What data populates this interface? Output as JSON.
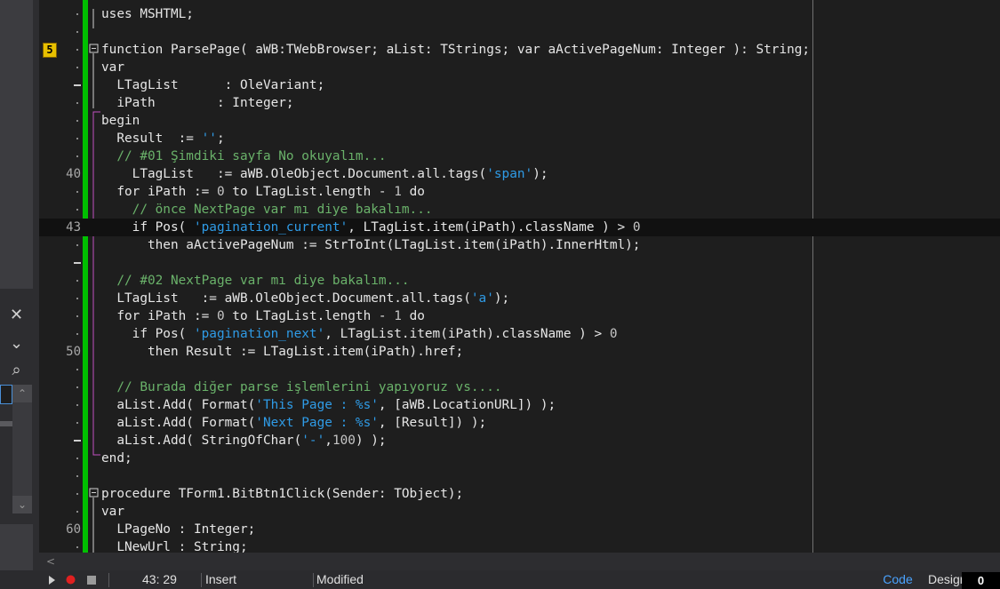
{
  "sidebar": {
    "close_glyph": "✕",
    "chevron_down": "⌄",
    "search_glyph": "⌕",
    "scroll_up": "⌃",
    "scroll_down": "⌄"
  },
  "gutter": {
    "bookmark": "5",
    "ln_40": "40",
    "ln_43": "43",
    "ln_50": "50",
    "ln_60": "60"
  },
  "code": {
    "l1": "uses MSHTML;",
    "l3_kw": "function",
    "l3_rest": " ParsePage( aWB:TWebBrowser; aList: TStrings; ",
    "l3_kw2": "var",
    "l3_rest2": " aActivePageNum: Integer ): String;",
    "l4": "var",
    "l5": "  LTagList      : OleVariant;",
    "l6": "  iPath        : Integer;",
    "l7": "begin",
    "l8_a": "  Result  := ",
    "l8_s": "''",
    "l8_b": ";",
    "l9": "  // #01 Şimdiki sayfa No okuyalım...",
    "l10_a": "    LTagList   := aWB.OleObject.Document.all.tags(",
    "l10_s": "'span'",
    "l10_b": ");",
    "l11_a": "  for iPath := ",
    "l11_n1": "0",
    "l11_b": " to LTagList.length - ",
    "l11_n2": "1",
    "l11_c": " do",
    "l12": "    // önce NextPage var mı diye bakalım...",
    "l13_a": "    if Pos( ",
    "l13_s": "'pagination_current'",
    "l13_b": ", LTagList.item(iPath).className ) > ",
    "l13_n": "0",
    "l14": "      then aActivePageNum := StrToInt(LTagList.item(iPath).InnerHtml);",
    "l16": "  // #02 NextPage var mı diye bakalım...",
    "l17_a": "  LTagList   := aWB.OleObject.Document.all.tags(",
    "l17_s": "'a'",
    "l17_b": ");",
    "l18_a": "  for iPath := ",
    "l18_n1": "0",
    "l18_b": " to LTagList.length - ",
    "l18_n2": "1",
    "l18_c": " do",
    "l19_a": "    if Pos( ",
    "l19_s": "'pagination_next'",
    "l19_b": ", LTagList.item(iPath).className ) > ",
    "l19_n": "0",
    "l20": "      then Result := LTagList.item(iPath).href;",
    "l22": "  // Burada diğer parse işlemlerini yapıyoruz vs....",
    "l23_a": "  aList.Add( Format(",
    "l23_s": "'This Page : %s'",
    "l23_b": ", [aWB.LocationURL]) );",
    "l24_a": "  aList.Add( Format(",
    "l24_s": "'Next Page : %s'",
    "l24_b": ", [Result]) );",
    "l25_a": "  aList.Add( StringOfChar(",
    "l25_s": "'-'",
    "l25_b": ",",
    "l25_n": "100",
    "l25_c": ") );",
    "l26": "end;",
    "l28": "procedure TForm1.BitBtn1Click(Sender: TObject);",
    "l29": "var",
    "l30": "  LPageNo : Integer;",
    "l31": "  LNewUrl : String;"
  },
  "statusbar": {
    "position": "43: 29",
    "mode": "Insert",
    "state": "Modified",
    "tab_code": "Code",
    "tab_design": "Design",
    "counter": "0"
  },
  "colors": {
    "modified_bar": "#00c000",
    "string": "#2f9be6",
    "comment": "#6ab26a",
    "tab_active": "#4aa3ff"
  }
}
